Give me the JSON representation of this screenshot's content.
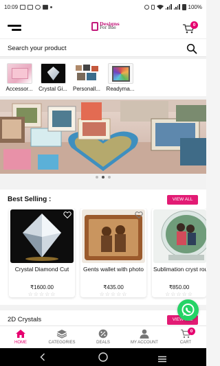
{
  "status_bar": {
    "time": "10:09",
    "battery": "100%"
  },
  "header": {
    "logo_line1": "Designs",
    "logo_line2": "For Bae",
    "cart_count": "0",
    "menu_icon": "hamburger-menu-icon",
    "cart_icon": "shopping-cart-icon"
  },
  "search": {
    "placeholder": "Search your product",
    "icon": "search-icon"
  },
  "categories": [
    {
      "label": "Accessor..."
    },
    {
      "label": "Crystal Gi..."
    },
    {
      "label": "Personall..."
    },
    {
      "label": "Readyma..."
    }
  ],
  "banner": {
    "active_slide": 2,
    "slide_count": 3
  },
  "best_selling": {
    "title": "Best Selling :",
    "view_all": "VIEW ALL",
    "products": [
      {
        "name": "Crystal Diamond Cut",
        "price": "₹1600.00",
        "stars": "☆☆☆☆☆"
      },
      {
        "name": "Gents wallet with photo",
        "price": "₹435.00",
        "stars": "☆☆☆☆☆"
      },
      {
        "name": "Sublimation cryst round small",
        "price": "₹850.00",
        "stars": "☆☆☆☆☆"
      }
    ]
  },
  "crystals_2d": {
    "title": "2D Crystals",
    "view_all": "VIEW ALL"
  },
  "bottom_nav": {
    "tabs": [
      {
        "label": "HOME",
        "icon": "home-icon"
      },
      {
        "label": "CATEGORIES",
        "icon": "layers-icon"
      },
      {
        "label": "DEALS",
        "icon": "discount-icon"
      },
      {
        "label": "MY ACCOUNT",
        "icon": "user-icon"
      },
      {
        "label": "CART",
        "icon": "cart-icon"
      }
    ],
    "cart_count": "0"
  },
  "colors": {
    "accent": "#e6006f",
    "button": "#e21b74",
    "whatsapp": "#25d366"
  }
}
